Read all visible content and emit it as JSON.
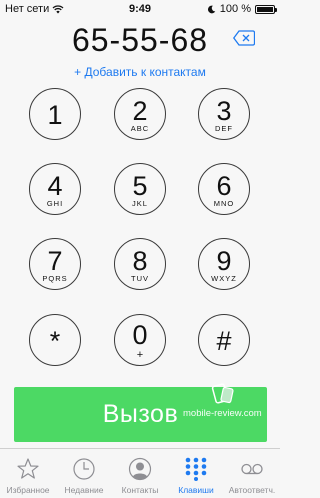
{
  "status_bar": {
    "carrier": "Нет сети",
    "time": "9:49",
    "battery": "100 %"
  },
  "dialer": {
    "number": "65-55-68",
    "add_to_contacts": "+ Добавить к контактам",
    "keys": [
      {
        "digit": "1",
        "letters": ""
      },
      {
        "digit": "2",
        "letters": "ABC"
      },
      {
        "digit": "3",
        "letters": "DEF"
      },
      {
        "digit": "4",
        "letters": "GHI"
      },
      {
        "digit": "5",
        "letters": "JKL"
      },
      {
        "digit": "6",
        "letters": "MNO"
      },
      {
        "digit": "7",
        "letters": "PQRS"
      },
      {
        "digit": "8",
        "letters": "TUV"
      },
      {
        "digit": "9",
        "letters": "WXYZ"
      },
      {
        "digit": "*",
        "letters": ""
      },
      {
        "digit": "0",
        "letters": "+"
      },
      {
        "digit": "#",
        "letters": ""
      }
    ],
    "call_label": "Вызов"
  },
  "watermark": "mobile-review.com",
  "tab_bar": {
    "active": "keypad",
    "tabs": [
      {
        "id": "favorites",
        "label": "Избранное",
        "icon": "star-icon"
      },
      {
        "id": "recents",
        "label": "Недавние",
        "icon": "clock-icon"
      },
      {
        "id": "contacts",
        "label": "Контакты",
        "icon": "person-icon"
      },
      {
        "id": "keypad",
        "label": "Клавиши",
        "icon": "keypad-icon"
      },
      {
        "id": "voicemail",
        "label": "Автоответч.",
        "icon": "voicemail-icon"
      }
    ]
  },
  "colors": {
    "accent": "#1e7af0",
    "call_green": "#4cd964",
    "inactive_gray": "#8e8e93"
  }
}
